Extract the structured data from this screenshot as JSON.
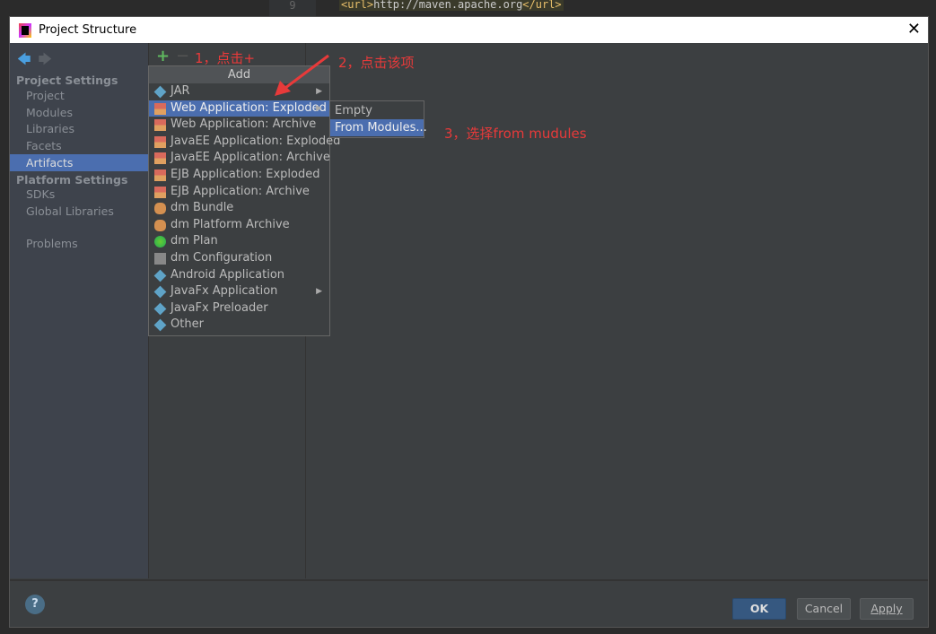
{
  "background_editor": {
    "line_number": "9",
    "code_tag_open": "<url>",
    "code_text": "http://maven.apache.org",
    "code_tag_close": "</url>"
  },
  "dialog": {
    "title": "Project Structure",
    "close": "✕"
  },
  "sidebar": {
    "back": "🡄",
    "forward": "🡆",
    "project_settings": "Project Settings",
    "items": [
      "Project",
      "Modules",
      "Libraries",
      "Facets",
      "Artifacts"
    ],
    "platform_settings": "Platform Settings",
    "platform_items": [
      "SDKs",
      "Global Libraries"
    ],
    "problems": "Problems",
    "selected": "Artifacts"
  },
  "toolbar": {
    "add": "+",
    "remove": "−"
  },
  "add_menu": {
    "header": "Add",
    "items": [
      {
        "label": "JAR",
        "icon": "jar-icon",
        "submenu": true
      },
      {
        "label": "Web Application: Exploded",
        "icon": "web-app-icon",
        "submenu": true,
        "selected": true
      },
      {
        "label": "Web Application: Archive",
        "icon": "web-app-icon"
      },
      {
        "label": "JavaEE Application: Exploded",
        "icon": "javaee-icon"
      },
      {
        "label": "JavaEE Application: Archive",
        "icon": "javaee-icon"
      },
      {
        "label": "EJB Application: Exploded",
        "icon": "ejb-icon"
      },
      {
        "label": "EJB Application: Archive",
        "icon": "ejb-icon"
      },
      {
        "label": "dm Bundle",
        "icon": "dm-bundle-icon"
      },
      {
        "label": "dm Platform Archive",
        "icon": "dm-archive-icon"
      },
      {
        "label": "dm Plan",
        "icon": "dm-plan-icon"
      },
      {
        "label": "dm Configuration",
        "icon": "dm-config-icon"
      },
      {
        "label": "Android Application",
        "icon": "android-icon"
      },
      {
        "label": "JavaFx Application",
        "icon": "javafx-icon",
        "submenu": true
      },
      {
        "label": "JavaFx Preloader",
        "icon": "javafx-icon"
      },
      {
        "label": "Other",
        "icon": "other-icon"
      }
    ]
  },
  "submenu": {
    "items": [
      "Empty",
      "From Modules..."
    ],
    "selected": "From Modules..."
  },
  "annotations": {
    "step1": "1，点击+",
    "step2": "2，点击该项",
    "step3": "3，选择from mudules",
    "color": "#e83a3a"
  },
  "footer": {
    "help": "?",
    "ok": "OK",
    "cancel": "Cancel",
    "apply": "Apply"
  }
}
